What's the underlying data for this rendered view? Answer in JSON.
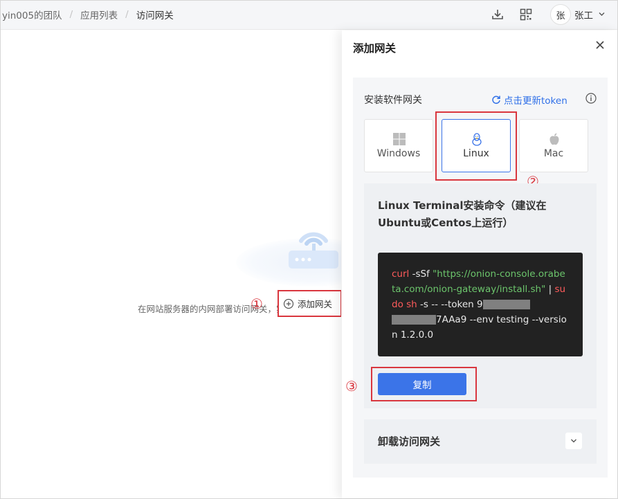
{
  "breadcrumb": {
    "team": "yin005的团队",
    "apps": "应用列表",
    "current": "访问网关",
    "separator": "/"
  },
  "header": {
    "icons": [
      "download-icon",
      "qrcode-icon"
    ],
    "avatar_char": "张",
    "user_name": "张工"
  },
  "main": {
    "empty_description": "在网站服务器的内网部署访问网关，实现内网资",
    "add_gateway_label": "添加网关",
    "step1": "①"
  },
  "drawer": {
    "title": "添加网关",
    "section_title": "安装软件网关",
    "refresh_label": "点击更新token",
    "os_options": [
      {
        "label": "Windows",
        "icon": "windows-icon",
        "selected": false
      },
      {
        "label": "Linux",
        "icon": "linux-icon",
        "selected": true
      },
      {
        "label": "Mac",
        "icon": "apple-icon",
        "selected": false
      }
    ],
    "step2": "②",
    "command_title": "Linux Terminal安装命令（建议在Ubuntu或Centos上运行）",
    "command": {
      "curl": "curl",
      "flag": " -sSf ",
      "url": "\"https://onion-console.orabeta.com/onion-gateway/install.sh\"",
      "pipe": " | ",
      "sudo_sh": "sudo sh",
      "args": " -s -- --token 9",
      "token_tail": "7AAa9",
      "rest": " --env testing --version 1.2.0.0"
    },
    "copy_label": "复制",
    "step3": "③",
    "uninstall_title": "卸载访问网关"
  },
  "colors": {
    "accent": "#3b74e8",
    "highlight": "#d9363e",
    "code_bg": "#222222"
  }
}
